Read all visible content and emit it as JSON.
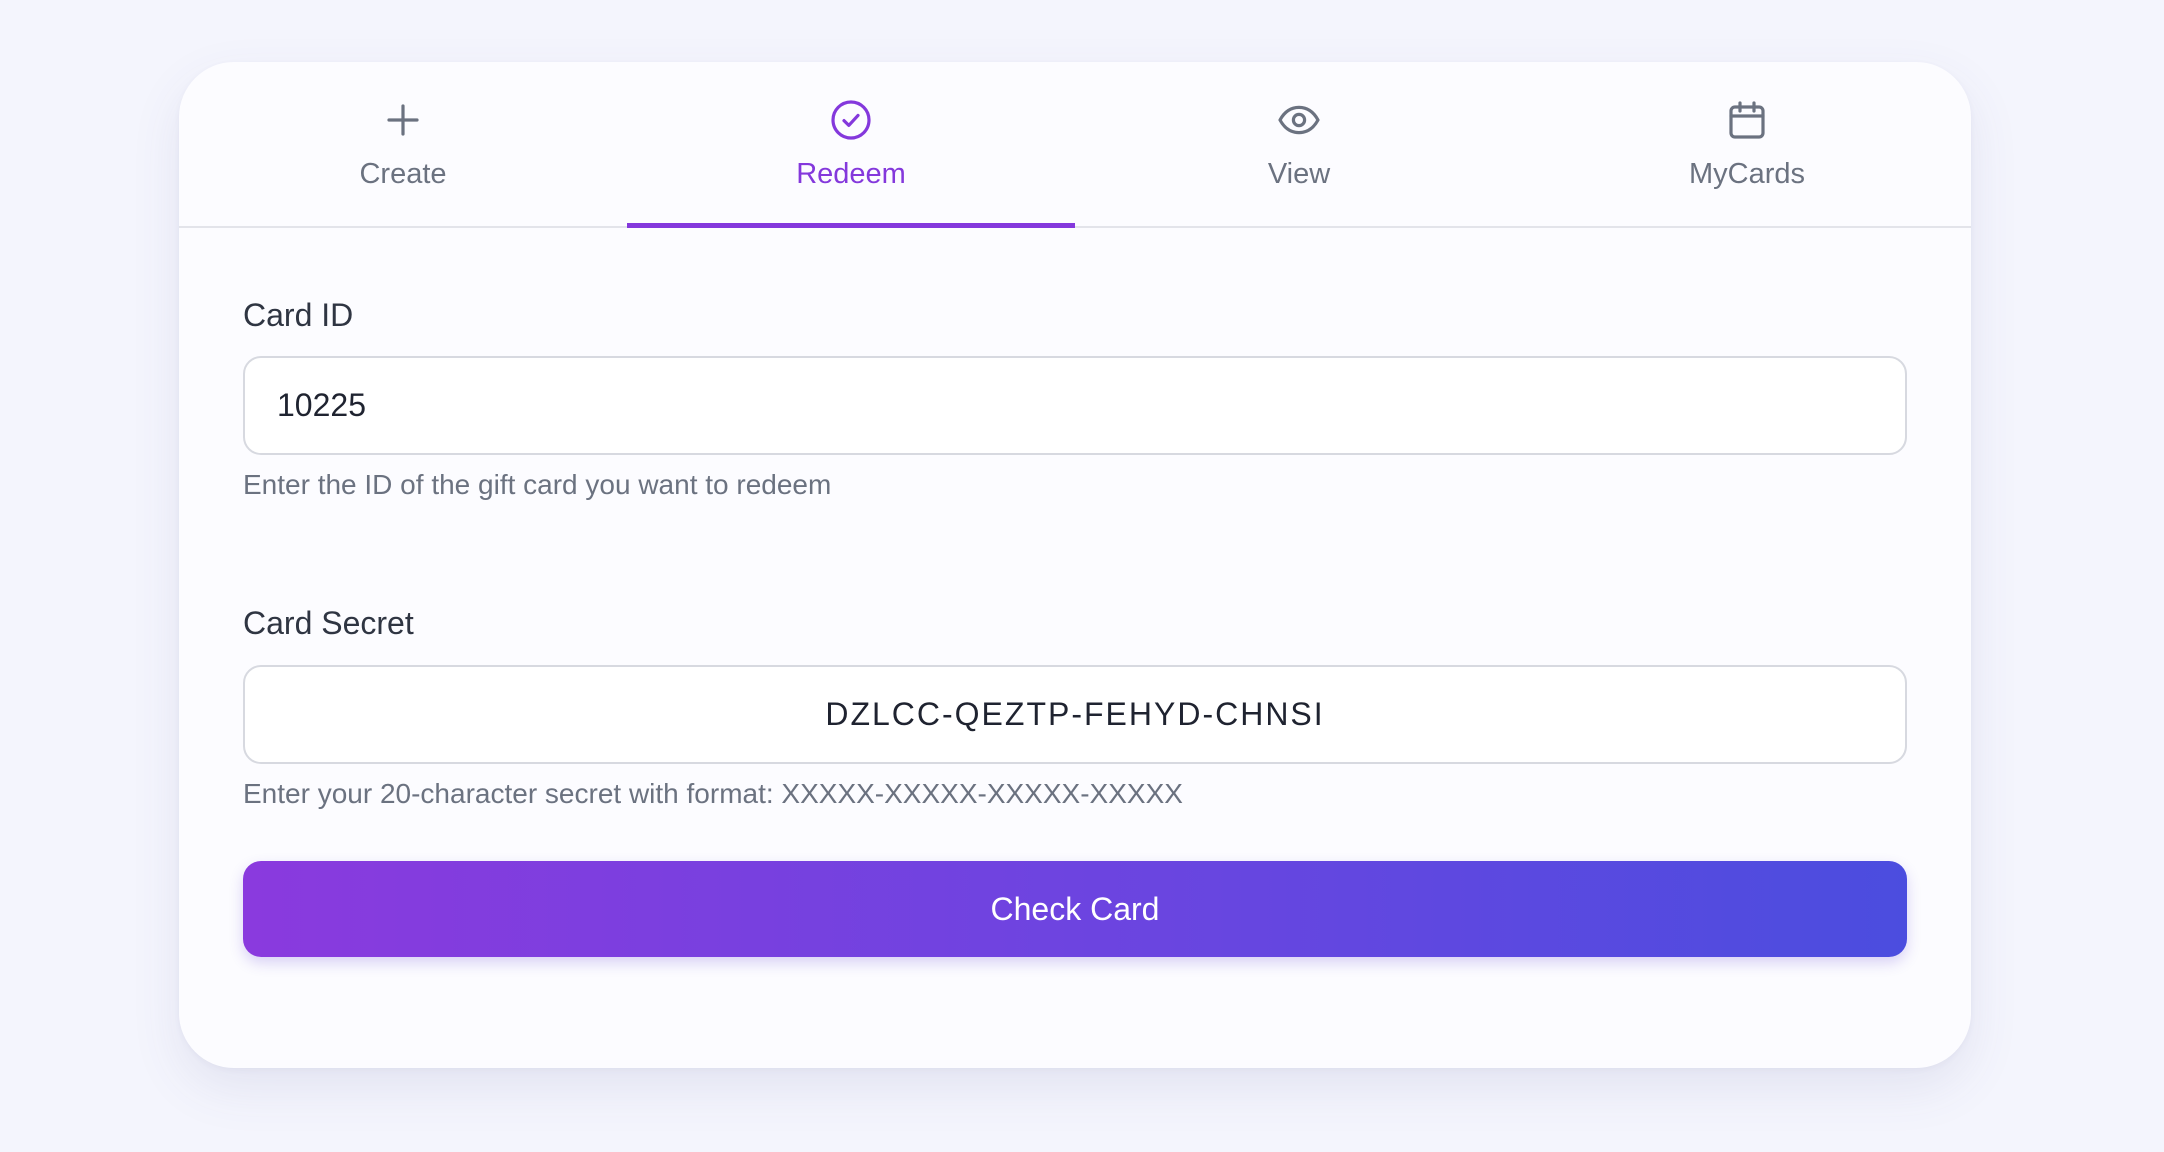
{
  "tabs": [
    {
      "label": "Create",
      "icon": "plus-icon",
      "active": false
    },
    {
      "label": "Redeem",
      "icon": "check-circle-icon",
      "active": true
    },
    {
      "label": "View",
      "icon": "eye-icon",
      "active": false
    },
    {
      "label": "MyCards",
      "icon": "calendar-icon",
      "active": false
    }
  ],
  "form": {
    "card_id": {
      "label": "Card ID",
      "value": "10225",
      "helper": "Enter the ID of the gift card you want to redeem"
    },
    "card_secret": {
      "label": "Card Secret",
      "value": "DZLCC-QEZTP-FEHYD-CHNSI",
      "helper": "Enter your 20-character secret with format: XXXXX-XXXXX-XXXXX-XXXXX"
    },
    "submit_label": "Check Card"
  },
  "colors": {
    "accent": "#8438dc",
    "button_gradient_start": "#8a3ade",
    "button_gradient_end": "#4b4ddf",
    "muted_text": "#6b7280",
    "page_background": "#f4f5fd"
  }
}
